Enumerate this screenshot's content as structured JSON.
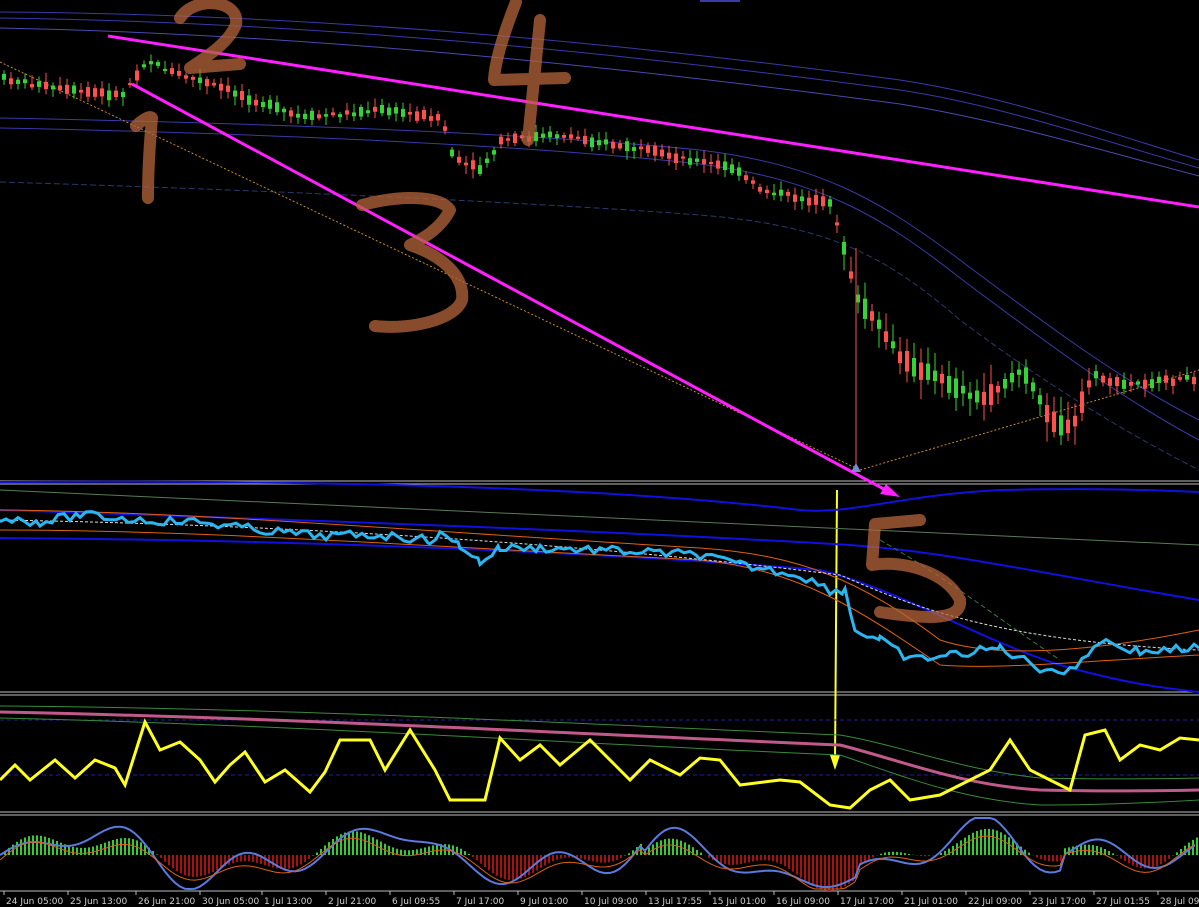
{
  "chart_data": {
    "type": "candlestick",
    "panels": [
      "price",
      "oscillator-1",
      "oscillator-2",
      "histogram"
    ],
    "time_labels": [
      "24 Jun 05:00",
      "25 Jun 13:00",
      "26 Jun 21:00",
      "30 Jun 05:00",
      "1 Jul 13:00",
      "2 Jul 21:00",
      "6 Jul 09:55",
      "7 Jul 17:00",
      "9 Jul 01:00",
      "10 Jul 09:00",
      "13 Jul 17:55",
      "15 Jul 01:00",
      "16 Jul 09:00",
      "17 Jul 17:00",
      "21 Jul 01:00",
      "22 Jul 09:00",
      "23 Jul 17:00",
      "27 Jul 01:55",
      "28 Jul 09:0"
    ],
    "annotations": [
      "1",
      "2",
      "3",
      "4",
      "5"
    ],
    "colors": {
      "background": "#000000",
      "bull_candle": "#35d435",
      "bear_candle": "#ff5050",
      "trendline": "#ff1fff",
      "envelope": "#3a3aa8",
      "cyan_line": "#2ab6f0",
      "yellow_line": "#ffff20",
      "blue_band": "#1010e0",
      "hist_up": "#33cc33",
      "hist_down": "#aa1010",
      "orange_line": "#e06010",
      "handwriting": "#b5643a"
    }
  }
}
